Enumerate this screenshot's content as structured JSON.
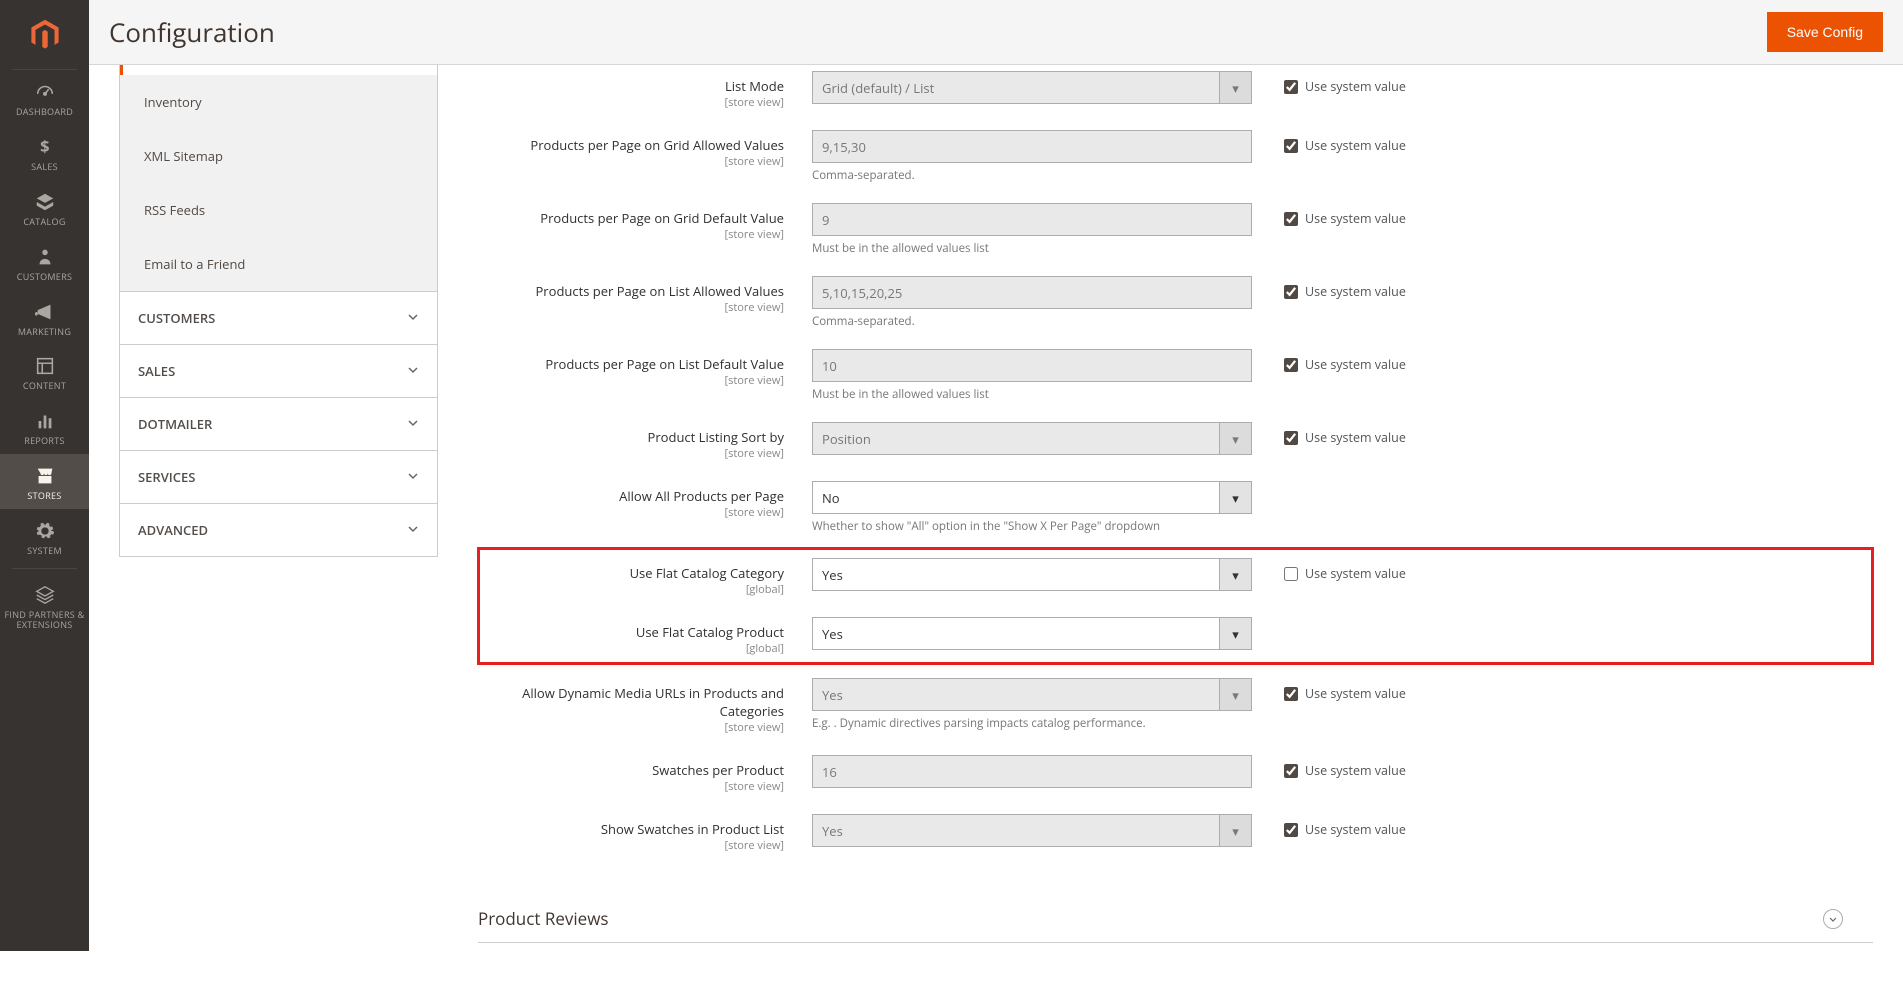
{
  "page_title": "Configuration",
  "save_button": "Save Config",
  "nav": {
    "dashboard": "DASHBOARD",
    "sales": "SALES",
    "catalog": "CATALOG",
    "customers": "CUSTOMERS",
    "marketing": "MARKETING",
    "content": "CONTENT",
    "reports": "REPORTS",
    "stores": "STORES",
    "system": "SYSTEM",
    "partners": "FIND PARTNERS & EXTENSIONS"
  },
  "tabs": {
    "catalog_sub": [
      "Inventory",
      "XML Sitemap",
      "RSS Feeds",
      "Email to a Friend"
    ],
    "groups": [
      "CUSTOMERS",
      "SALES",
      "DOTMAILER",
      "SERVICES",
      "ADVANCED"
    ]
  },
  "scope_store": "[store view]",
  "scope_global": "[global]",
  "use_system": "Use system value",
  "fields": {
    "list_mode": {
      "label": "List Mode",
      "value": "Grid (default) / List"
    },
    "grid_allowed": {
      "label": "Products per Page on Grid Allowed Values",
      "value": "9,15,30",
      "help": "Comma-separated."
    },
    "grid_default": {
      "label": "Products per Page on Grid Default Value",
      "value": "9",
      "help": "Must be in the allowed values list"
    },
    "list_allowed": {
      "label": "Products per Page on List Allowed Values",
      "value": "5,10,15,20,25",
      "help": "Comma-separated."
    },
    "list_default": {
      "label": "Products per Page on List Default Value",
      "value": "10",
      "help": "Must be in the allowed values list"
    },
    "sort_by": {
      "label": "Product Listing Sort by",
      "value": "Position"
    },
    "allow_all": {
      "label": "Allow All Products per Page",
      "value": "No",
      "help": "Whether to show \"All\" option in the \"Show X Per Page\" dropdown"
    },
    "flat_cat": {
      "label": "Use Flat Catalog Category",
      "value": "Yes"
    },
    "flat_prod": {
      "label": "Use Flat Catalog Product",
      "value": "Yes"
    },
    "dyn_media": {
      "label": "Allow Dynamic Media URLs in Products and Categories",
      "value": "Yes",
      "help": "E.g. . Dynamic directives parsing impacts catalog performance."
    },
    "swatches": {
      "label": "Swatches per Product",
      "value": "16"
    },
    "show_swatches": {
      "label": "Show Swatches in Product List",
      "value": "Yes"
    }
  },
  "section_reviews": "Product Reviews"
}
